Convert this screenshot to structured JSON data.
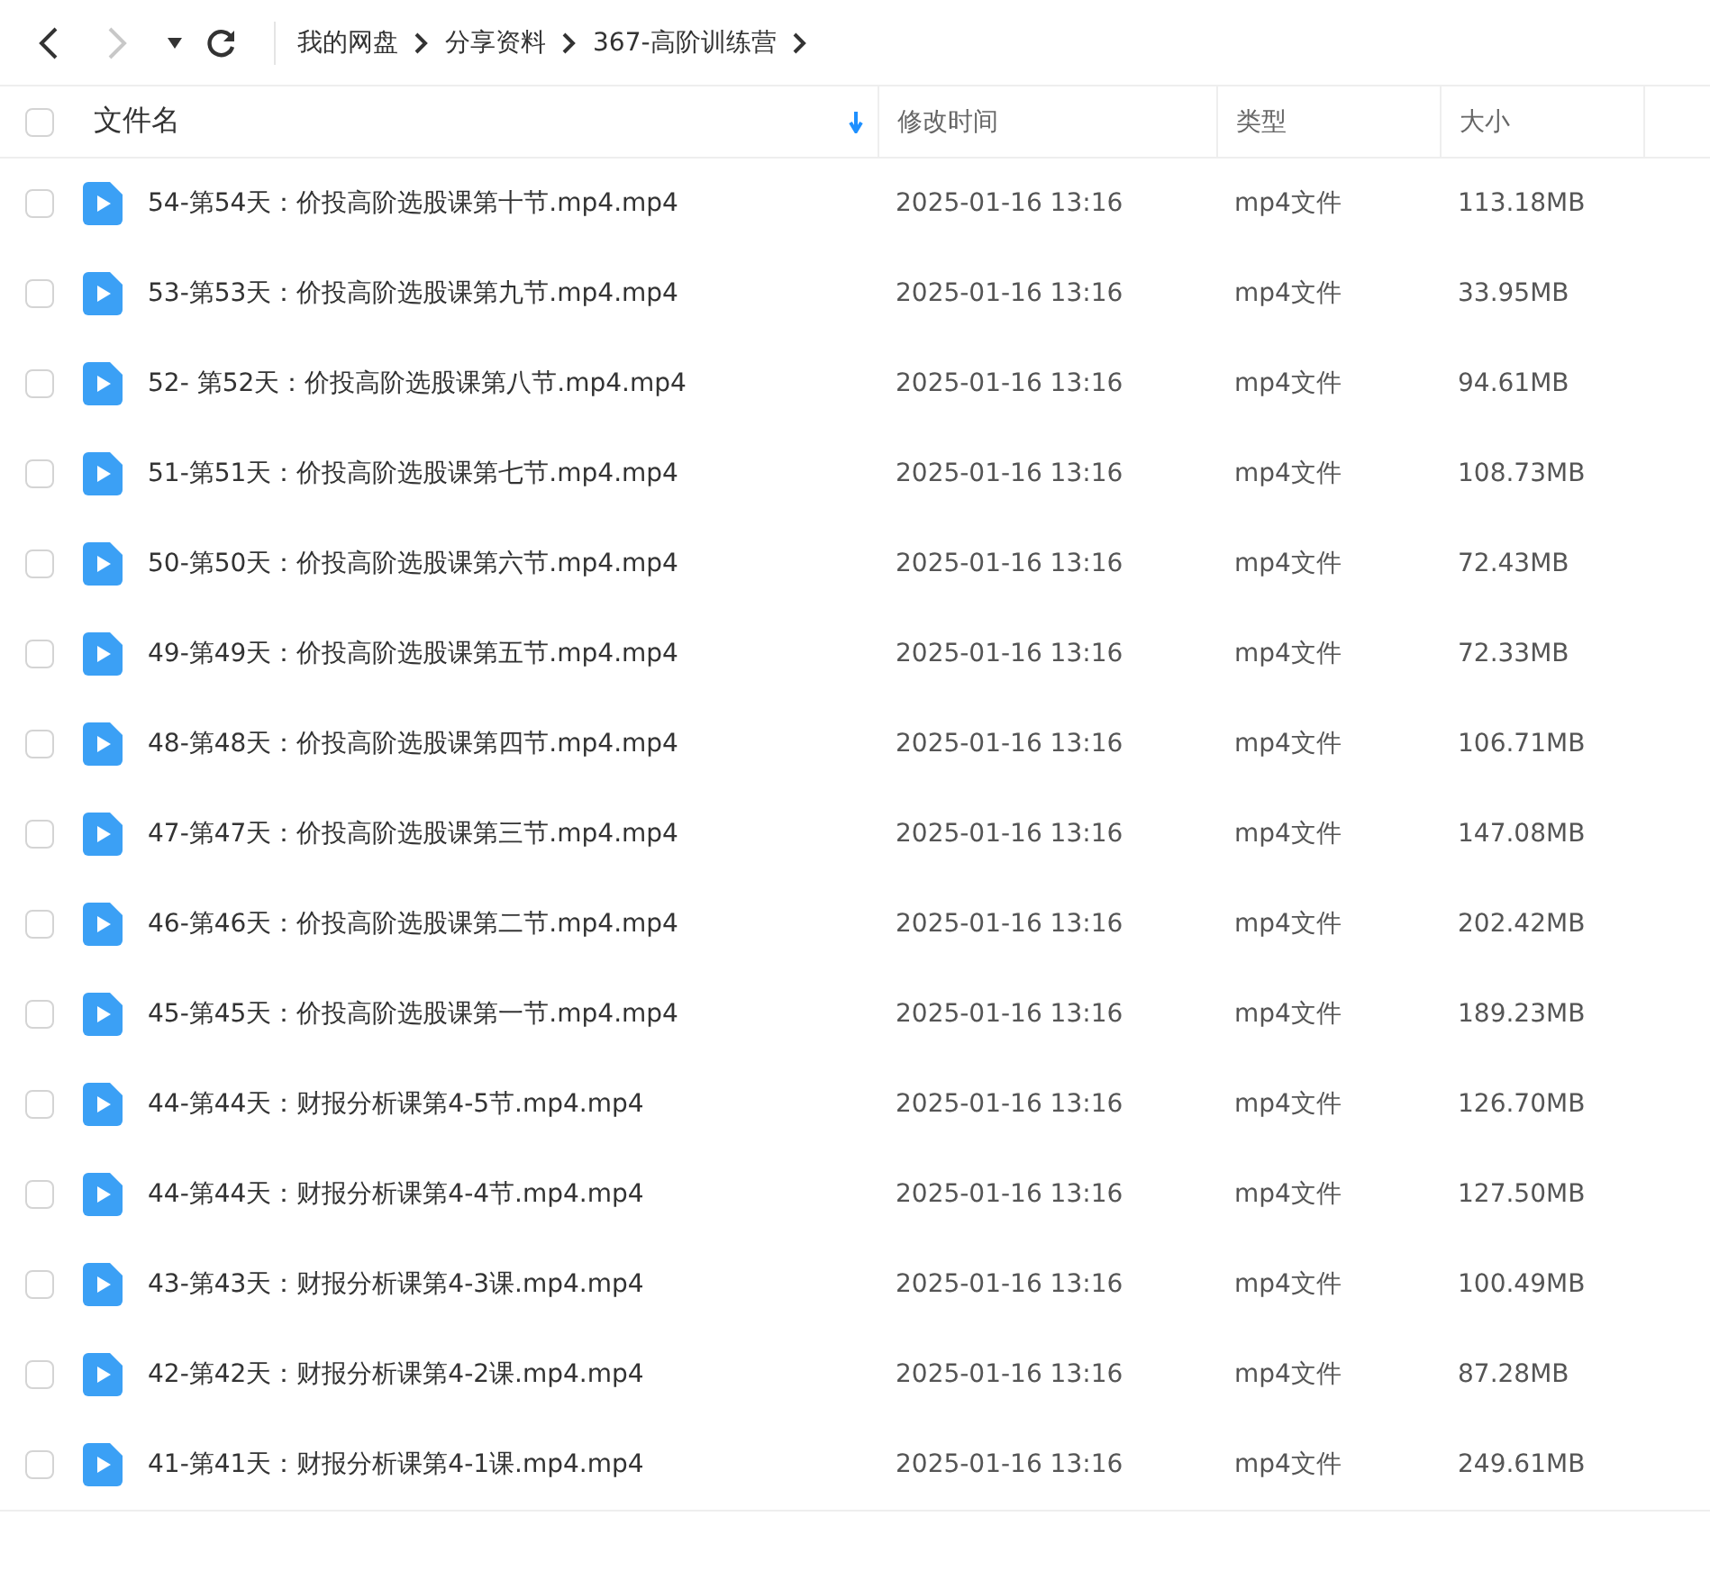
{
  "toolbar": {
    "back": {
      "disabled": false
    },
    "forward": {
      "disabled": true
    },
    "breadcrumbs": [
      "我的网盘",
      "分享资料",
      "367-高阶训练营"
    ]
  },
  "table": {
    "select_all": {
      "checked": false
    },
    "columns": [
      {
        "label": "文件名",
        "sorted": true
      },
      {
        "label": "修改时间",
        "sorted": false
      },
      {
        "label": "类型",
        "sorted": false
      },
      {
        "label": "大小",
        "sorted": false
      }
    ],
    "rows": [
      {
        "name": "54-第54天：价投高阶选股课第十节.mp4.mp4",
        "modified": "2025-01-16 13:16",
        "type": "mp4文件",
        "size": "113.18MB",
        "checked": false
      },
      {
        "name": "53-第53天：价投高阶选股课第九节.mp4.mp4",
        "modified": "2025-01-16 13:16",
        "type": "mp4文件",
        "size": "33.95MB",
        "checked": false
      },
      {
        "name": "52- 第52天：价投高阶选股课第八节.mp4.mp4",
        "modified": "2025-01-16 13:16",
        "type": "mp4文件",
        "size": "94.61MB",
        "checked": false
      },
      {
        "name": "51-第51天：价投高阶选股课第七节.mp4.mp4",
        "modified": "2025-01-16 13:16",
        "type": "mp4文件",
        "size": "108.73MB",
        "checked": false
      },
      {
        "name": "50-第50天：价投高阶选股课第六节.mp4.mp4",
        "modified": "2025-01-16 13:16",
        "type": "mp4文件",
        "size": "72.43MB",
        "checked": false
      },
      {
        "name": "49-第49天：价投高阶选股课第五节.mp4.mp4",
        "modified": "2025-01-16 13:16",
        "type": "mp4文件",
        "size": "72.33MB",
        "checked": false
      },
      {
        "name": "48-第48天：价投高阶选股课第四节.mp4.mp4",
        "modified": "2025-01-16 13:16",
        "type": "mp4文件",
        "size": "106.71MB",
        "checked": false
      },
      {
        "name": "47-第47天：价投高阶选股课第三节.mp4.mp4",
        "modified": "2025-01-16 13:16",
        "type": "mp4文件",
        "size": "147.08MB",
        "checked": false
      },
      {
        "name": "46-第46天：价投高阶选股课第二节.mp4.mp4",
        "modified": "2025-01-16 13:16",
        "type": "mp4文件",
        "size": "202.42MB",
        "checked": false
      },
      {
        "name": "45-第45天：价投高阶选股课第一节.mp4.mp4",
        "modified": "2025-01-16 13:16",
        "type": "mp4文件",
        "size": "189.23MB",
        "checked": false
      },
      {
        "name": "44-第44天：财报分析课第4-5节.mp4.mp4",
        "modified": "2025-01-16 13:16",
        "type": "mp4文件",
        "size": "126.70MB",
        "checked": false
      },
      {
        "name": "44-第44天：财报分析课第4-4节.mp4.mp4",
        "modified": "2025-01-16 13:16",
        "type": "mp4文件",
        "size": "127.50MB",
        "checked": false
      },
      {
        "name": "43-第43天：财报分析课第4-3课.mp4.mp4",
        "modified": "2025-01-16 13:16",
        "type": "mp4文件",
        "size": "100.49MB",
        "checked": false
      },
      {
        "name": "42-第42天：财报分析课第4-2课.mp4.mp4",
        "modified": "2025-01-16 13:16",
        "type": "mp4文件",
        "size": "87.28MB",
        "checked": false
      },
      {
        "name": "41-第41天：财报分析课第4-1课.mp4.mp4",
        "modified": "2025-01-16 13:16",
        "type": "mp4文件",
        "size": "249.61MB",
        "checked": false
      }
    ]
  }
}
